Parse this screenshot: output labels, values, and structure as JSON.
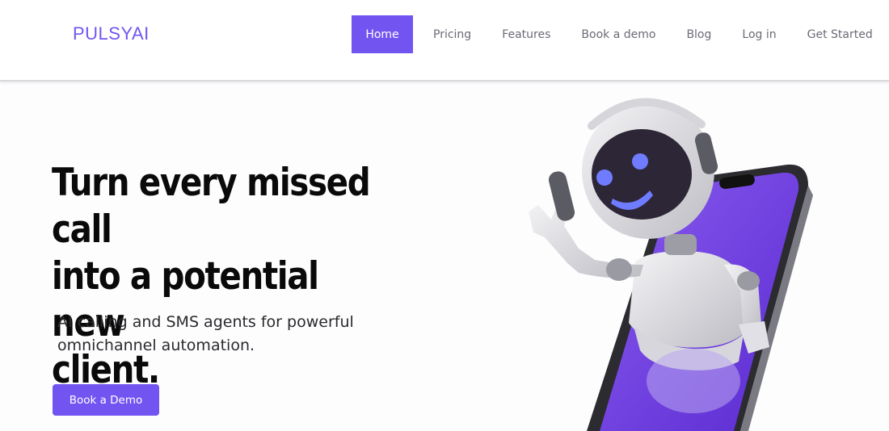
{
  "brand": {
    "logo": "PULSYAI",
    "accent": "#7255f1"
  },
  "nav": {
    "items": [
      {
        "label": "Home",
        "active": true
      },
      {
        "label": "Pricing"
      },
      {
        "label": "Features"
      },
      {
        "label": "Book a demo"
      },
      {
        "label": "Blog"
      },
      {
        "label": "Log in"
      },
      {
        "label": "Get Started"
      }
    ]
  },
  "hero": {
    "headline_lines": [
      "Turn every missed call",
      "into a potential new",
      "client."
    ],
    "subtext_lines": [
      "AI calling and SMS agents for powerful",
      "omnichannel automation."
    ],
    "cta_label": "Book a Demo",
    "illustration": "robot-waving-from-phone"
  }
}
